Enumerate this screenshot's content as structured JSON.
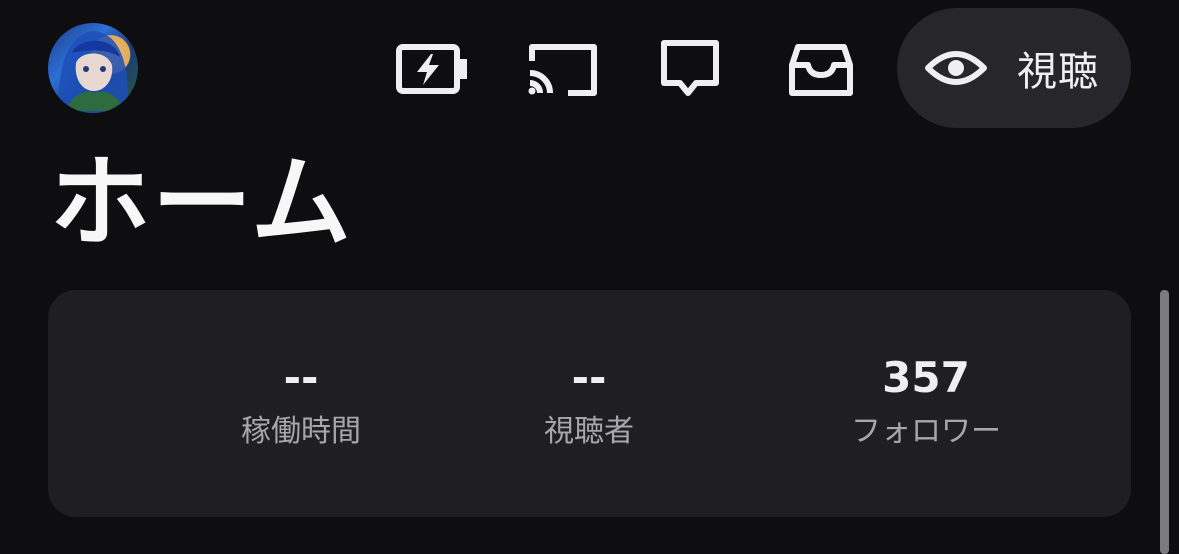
{
  "header": {
    "title": "ホーム",
    "watch_label": "視聴",
    "icons": [
      "battery-bolt-icon",
      "cast-icon",
      "chat-icon",
      "inbox-icon",
      "eye-icon"
    ]
  },
  "stats": [
    {
      "value": "--",
      "label": "稼働時間"
    },
    {
      "value": "--",
      "label": "視聴者"
    },
    {
      "value": "357",
      "label": "フォロワー"
    }
  ],
  "colors": {
    "background": "#0e0e10",
    "card": "#1f1f23",
    "pill": "#26262b",
    "text": "#efeff1",
    "muted": "#a6a6ad"
  }
}
